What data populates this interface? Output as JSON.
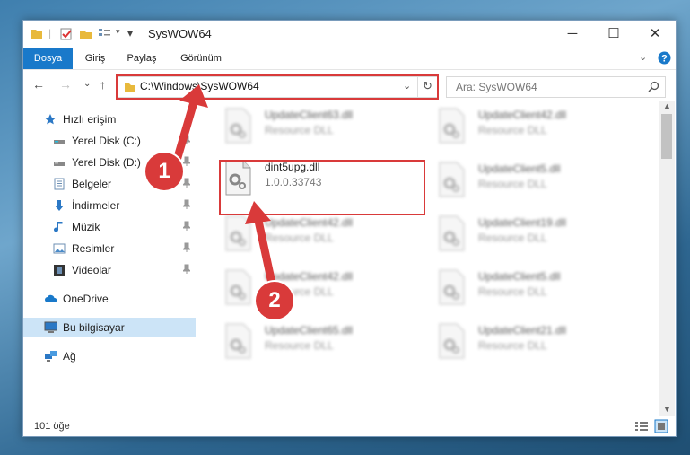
{
  "window": {
    "title": "SysWOW64",
    "minimize": "─",
    "maximize": "☐",
    "close": "✕"
  },
  "ribbon": {
    "tabs": [
      "Dosya",
      "Giriş",
      "Paylaş",
      "Görünüm"
    ]
  },
  "address": {
    "path": "C:\\Windows\\SysWOW64",
    "search_placeholder": "Ara: SysWOW64"
  },
  "sidebar": {
    "quick_access": "Hızlı erişim",
    "items": [
      "Yerel Disk (C:)",
      "Yerel Disk (D:)",
      "Belgeler",
      "İndirmeler",
      "Müzik",
      "Resimler",
      "Videolar"
    ],
    "onedrive": "OneDrive",
    "this_pc": "Bu bilgisayar",
    "network": "Ağ"
  },
  "files": {
    "left": [
      {
        "name": "UpdateClient63.dll",
        "desc": "Resource DLL"
      },
      {
        "name": "dint5upg.dll",
        "desc": "1.0.0.33743"
      },
      {
        "name": "UpdateClient42.dll",
        "desc": "Resource DLL"
      },
      {
        "name": "UpdateClient42.dll",
        "desc": "Resource DLL"
      },
      {
        "name": "UpdateClient65.dll",
        "desc": "Resource DLL"
      }
    ],
    "right": [
      {
        "name": "UpdateClient42.dll",
        "desc": "Resource DLL"
      },
      {
        "name": "UpdateClient5.dll",
        "desc": "Resource DLL"
      },
      {
        "name": "UpdateClient19.dll",
        "desc": "Resource DLL"
      },
      {
        "name": "UpdateClient5.dll",
        "desc": "Resource DLL"
      },
      {
        "name": "UpdateClient21.dll",
        "desc": "Resource DLL"
      }
    ]
  },
  "status": {
    "count": "101 öğe"
  },
  "markers": [
    "1",
    "2"
  ],
  "colors": {
    "accent": "#1979ca",
    "highlight": "#d93a3a",
    "selected": "#cce4f7"
  }
}
